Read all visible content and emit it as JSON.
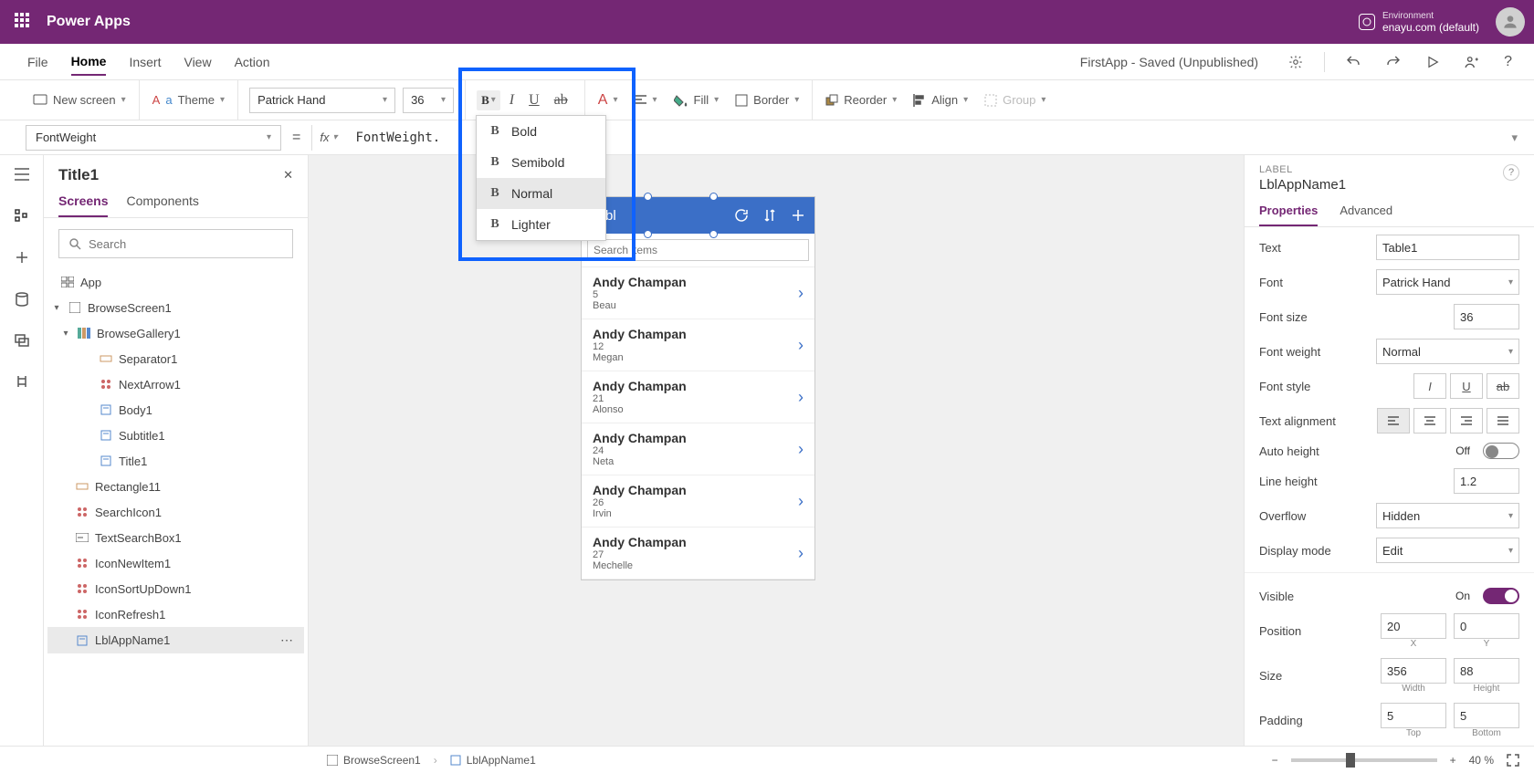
{
  "topbar": {
    "brand": "Power Apps",
    "env_label": "Environment",
    "env_value": "enayu.com (default)"
  },
  "menubar": {
    "file": "File",
    "home": "Home",
    "insert": "Insert",
    "view": "View",
    "action": "Action",
    "saved": "FirstApp - Saved (Unpublished)"
  },
  "ribbon": {
    "newscreen": "New screen",
    "theme": "Theme",
    "font": "Patrick Hand",
    "size": "36",
    "fill": "Fill",
    "border": "Border",
    "reorder": "Reorder",
    "align": "Align",
    "group": "Group"
  },
  "fontweight_menu": {
    "bold": "Bold",
    "semibold": "Semibold",
    "normal": "Normal",
    "lighter": "Lighter"
  },
  "formula": {
    "prop": "FontWeight",
    "expr": "FontWeight."
  },
  "tree": {
    "title": "Title1",
    "tab_screens": "Screens",
    "tab_components": "Components",
    "search_ph": "Search",
    "app": "App",
    "browsescreen": "BrowseScreen1",
    "gallery": "BrowseGallery1",
    "sep": "Separator1",
    "next": "NextArrow1",
    "body": "Body1",
    "subtitle": "Subtitle1",
    "rect": "Rectangle11",
    "searchicon": "SearchIcon1",
    "textsearch": "TextSearchBox1",
    "iconnew": "IconNewItem1",
    "iconsort": "IconSortUpDown1",
    "iconrefresh": "IconRefresh1",
    "lblapp": "LblAppName1"
  },
  "canvas": {
    "header_title": "Table1",
    "search_ph": "Search items",
    "rows": [
      {
        "name": "Andy Champan",
        "num": "5",
        "sub": "Beau"
      },
      {
        "name": "Andy Champan",
        "num": "12",
        "sub": "Megan"
      },
      {
        "name": "Andy Champan",
        "num": "21",
        "sub": "Alonso"
      },
      {
        "name": "Andy Champan",
        "num": "24",
        "sub": "Neta"
      },
      {
        "name": "Andy Champan",
        "num": "26",
        "sub": "Irvin"
      },
      {
        "name": "Andy Champan",
        "num": "27",
        "sub": "Mechelle"
      }
    ]
  },
  "props": {
    "kind": "LABEL",
    "name": "LblAppName1",
    "tab_props": "Properties",
    "tab_adv": "Advanced",
    "text_lbl": "Text",
    "text_val": "Table1",
    "font_lbl": "Font",
    "font_val": "Patrick Hand",
    "fontsize_lbl": "Font size",
    "fontsize_val": "36",
    "fw_lbl": "Font weight",
    "fw_val": "Normal",
    "fs_lbl": "Font style",
    "ta_lbl": "Text alignment",
    "ah_lbl": "Auto height",
    "ah_val": "Off",
    "lh_lbl": "Line height",
    "lh_val": "1.2",
    "ov_lbl": "Overflow",
    "ov_val": "Hidden",
    "dm_lbl": "Display mode",
    "dm_val": "Edit",
    "vis_lbl": "Visible",
    "vis_val": "On",
    "pos_lbl": "Position",
    "x_val": "20",
    "y_val": "0",
    "x_lbl": "X",
    "y_lbl": "Y",
    "size_lbl": "Size",
    "w_val": "356",
    "h_val": "88",
    "w_lbl": "Width",
    "h_lbl": "Height",
    "pad_lbl": "Padding",
    "t_val": "5",
    "b_val": "5",
    "t_lbl": "Top",
    "b_lbl": "Bottom"
  },
  "bottom": {
    "bc1": "BrowseScreen1",
    "bc2": "LblAppName1",
    "zoom": "40",
    "pct": "%"
  }
}
